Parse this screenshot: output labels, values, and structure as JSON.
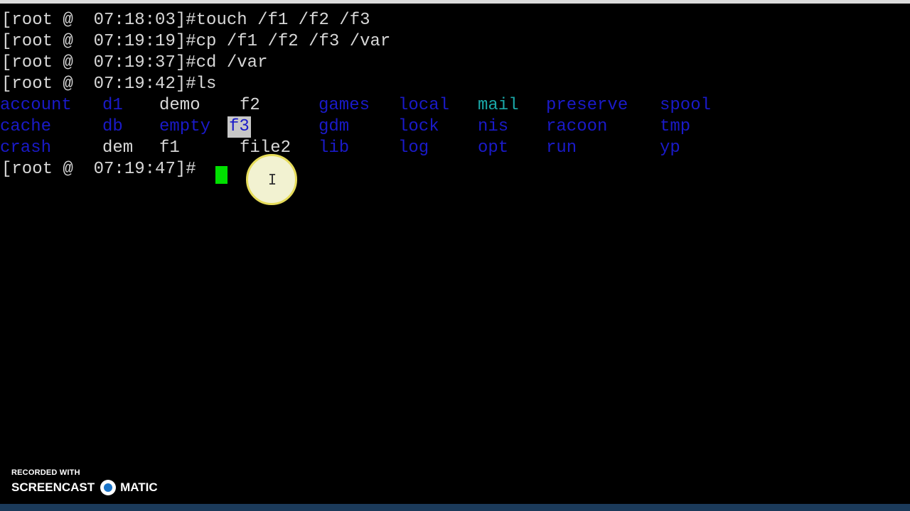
{
  "terminal": {
    "lines": [
      {
        "prompt": "[root @  07:18:03]#",
        "command": "touch /f1 /f2 /f3"
      },
      {
        "prompt": "[root @  07:19:19]#",
        "command": "cp /f1 /f2 /f3 /var"
      },
      {
        "prompt": "[root @  07:19:37]#",
        "command": "cd /var"
      },
      {
        "prompt": "[root @  07:19:42]#",
        "command": "ls"
      }
    ],
    "ls_output": [
      [
        "account",
        "d1",
        "demo",
        "f2",
        "games",
        "local",
        "mail",
        "preserve",
        "spool"
      ],
      [
        "cache",
        "db",
        "empty",
        "f3",
        "gdm",
        "lock",
        "nis",
        "racoon",
        "tmp"
      ],
      [
        "crash",
        "dem",
        "f1",
        "file2",
        "lib",
        "log",
        "opt",
        "run",
        "yp"
      ]
    ],
    "current_prompt": "[root @  07:19:47]#"
  },
  "colors": {
    "directory": "#1a1ac8",
    "executable": "#1aa8a8",
    "file": "#d8d8d8",
    "cursor": "#00e000"
  },
  "watermark": {
    "recorded_with": "RECORDED WITH",
    "brand_left": "SCREENCAST",
    "brand_right": "MATIC"
  }
}
